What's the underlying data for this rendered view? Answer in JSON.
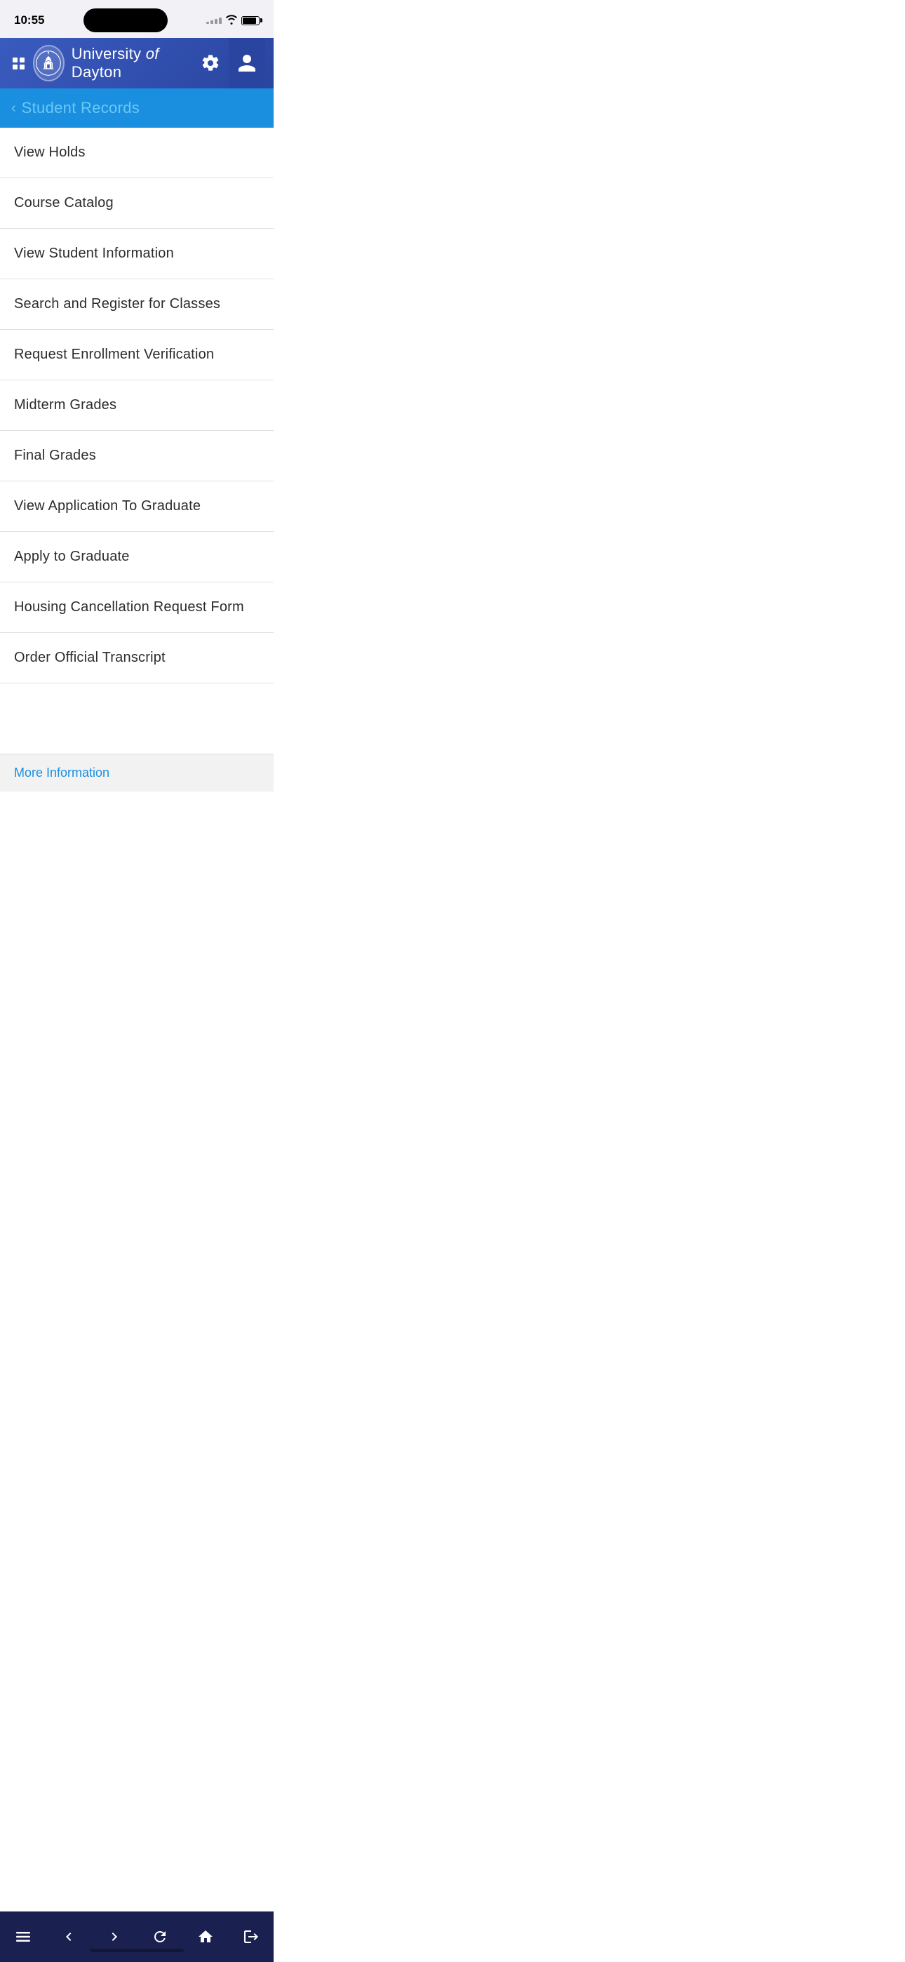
{
  "statusBar": {
    "time": "10:55"
  },
  "header": {
    "gridIconLabel": "grid-icon",
    "universityNamePart1": "University ",
    "universityNameItalic": "of",
    "universityNamePart2": " Dayton",
    "gearIconLabel": "settings",
    "profileIconLabel": "profile"
  },
  "backNav": {
    "label": "Student Records"
  },
  "menuItems": [
    {
      "id": "view-holds",
      "label": "View Holds"
    },
    {
      "id": "course-catalog",
      "label": "Course Catalog"
    },
    {
      "id": "view-student-information",
      "label": "View Student Information"
    },
    {
      "id": "search-register",
      "label": "Search and Register for Classes"
    },
    {
      "id": "enrollment-verification",
      "label": "Request Enrollment Verification"
    },
    {
      "id": "midterm-grades",
      "label": "Midterm Grades"
    },
    {
      "id": "final-grades",
      "label": "Final Grades"
    },
    {
      "id": "view-application-graduate",
      "label": "View Application To Graduate"
    },
    {
      "id": "apply-graduate",
      "label": "Apply to Graduate"
    },
    {
      "id": "housing-cancellation",
      "label": "Housing Cancellation Request Form"
    },
    {
      "id": "order-transcript",
      "label": "Order Official Transcript"
    }
  ],
  "moreInfo": {
    "label": "More Information"
  },
  "bottomNav": {
    "menuLabel": "menu",
    "backLabel": "back",
    "forwardLabel": "forward",
    "refreshLabel": "refresh",
    "homeLabel": "home",
    "logoutLabel": "logout"
  }
}
